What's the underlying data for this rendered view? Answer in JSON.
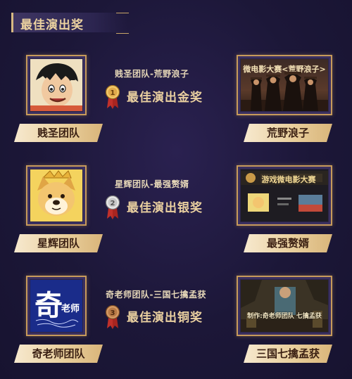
{
  "header": {
    "title": "最佳演出奖"
  },
  "awards": [
    {
      "team_line": "贱圣团队-荒野浪子",
      "award": "最佳演出金奖",
      "medal_num": "1",
      "medal_color": "#d9a441",
      "team_label": "贱圣团队",
      "work_label": "荒野浪子",
      "poster_title": "微电影大赛<荒野浪子>"
    },
    {
      "team_line": "星辉团队-最强赘婿",
      "award": "最佳演出银奖",
      "medal_num": "2",
      "medal_color": "#c9c9c9",
      "team_label": "星辉团队",
      "work_label": "最强赘婿",
      "poster_title": "游戏微电影大赛"
    },
    {
      "team_line": "奇老师团队-三国七擒孟获",
      "award": "最佳演出铜奖",
      "medal_num": "3",
      "medal_color": "#b87a46",
      "team_label": "奇老师团队",
      "work_label": "三国七擒孟获",
      "avatar_text_main": "奇",
      "avatar_text_sub": "老师",
      "poster_caption": "制作:奇老师团队 七擒孟获"
    }
  ]
}
